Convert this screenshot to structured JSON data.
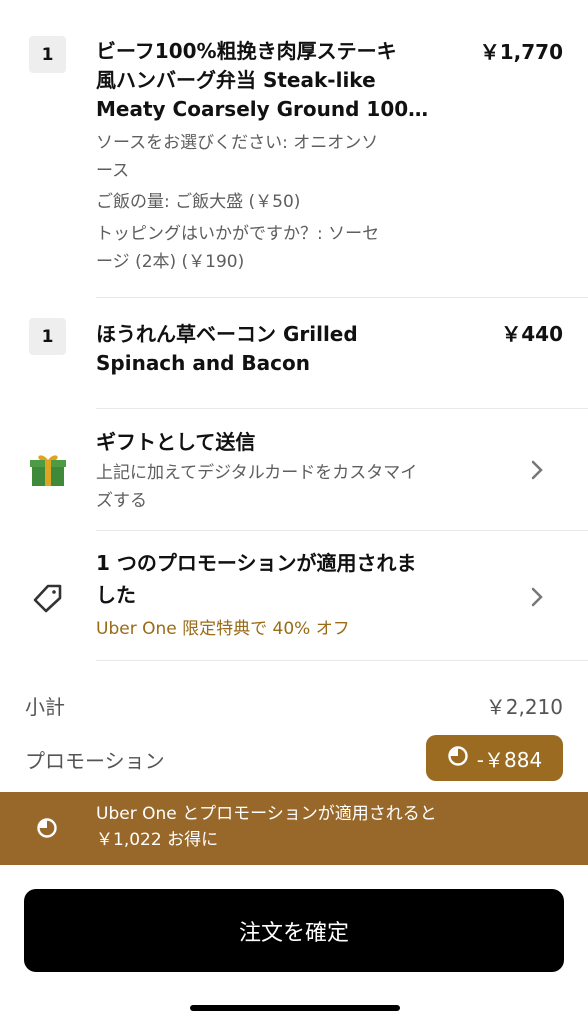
{
  "items": [
    {
      "qty": "1",
      "name_line1": "ビーフ100%粗挽き肉厚ステーキ",
      "name_line2": "風ハンバーグ弁当 Steak-like",
      "name_line3": "Meaty Coarsely Ground 100%...",
      "price": "￥1,770",
      "options": [
        "ソースをお選びください: オニオンソ",
        "ース",
        "ご飯の量: ご飯大盛 (￥50)",
        "トッピングはいかがですか？: ソーセ",
        "ージ (2本) (￥190)"
      ]
    },
    {
      "qty": "1",
      "name_line1": "ほうれん草ベーコン Grilled",
      "name_line2": "Spinach and Bacon",
      "price": "￥440"
    }
  ],
  "gift": {
    "icon": "gift-icon",
    "title": "ギフトとして送信",
    "sub_line1": "上記に加えてデジタルカードをカスタマイ",
    "sub_line2": "ズする"
  },
  "promotion": {
    "icon": "tag-icon",
    "title_line1": "1 つのプロモーションが適用されま",
    "title_line2": "した",
    "sub": "Uber One 限定特典で 40% オフ"
  },
  "summary": {
    "subtotal_label": "小計",
    "subtotal_value": "￥2,210",
    "promo_label": "プロモーション",
    "promo_value": "-￥884"
  },
  "banner": {
    "line1": "Uber One とプロモーションが適用されると",
    "line2": "￥1,022 お得に"
  },
  "cta_label": "注文を確定",
  "colors": {
    "gold": "#98682a",
    "gold_text": "#9a6b16",
    "gift_green": "#3f8a3a",
    "gift_ribbon": "#e0a423"
  }
}
